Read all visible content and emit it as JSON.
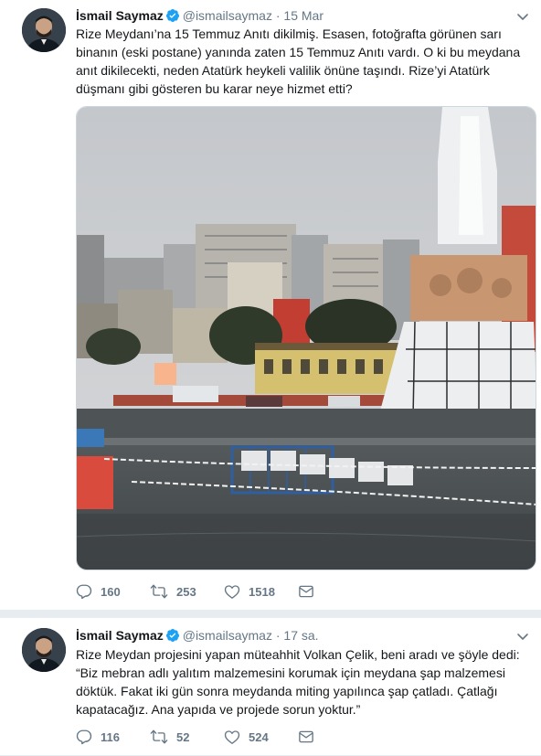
{
  "tweets": [
    {
      "author_name": "İsmail Saymaz",
      "handle": "@ismailsaymaz",
      "separator": "·",
      "time": "15 Mar",
      "text": "Rize Meydanı’na 15 Temmuz Anıtı dikilmiş. Esasen, fotoğrafta görünen sarı binanın (eski postane) yanında zaten 15 Temmuz Anıtı vardı. O ki bu meydana anıt dikilecekti, neden Atatürk heykeli valilik önüne taşındı. Rize’yi Atatürk düşmanı gibi gösteren bu karar neye hizmet etti?",
      "media": "photo-rize-square-monument",
      "replies": "160",
      "retweets": "253",
      "likes": "1518"
    },
    {
      "author_name": "İsmail Saymaz",
      "handle": "@ismailsaymaz",
      "separator": "·",
      "time": "17 sa.",
      "text": "Rize Meydan projesini yapan müteahhit Volkan Çelik, beni aradı ve şöyle dedi:\n“Biz mebran adlı yalıtım malzemesini korumak için meydana şap malzemesi döktük. Fakat iki gün sonra meydanda miting yapılınca şap çatladı. Çatlağı kapatacağız. Ana yapıda ve projede sorun yoktur.”",
      "replies": "116",
      "retweets": "52",
      "likes": "524"
    }
  ],
  "icons": {
    "verified": "verified-badge-icon",
    "caret": "chevron-down-icon",
    "reply": "reply-icon",
    "retweet": "retweet-icon",
    "like": "heart-icon",
    "dm": "envelope-icon"
  },
  "colors": {
    "verified": "#1da1f2",
    "muted": "#657786",
    "text": "#14171a",
    "background": "#e6ecf0"
  }
}
